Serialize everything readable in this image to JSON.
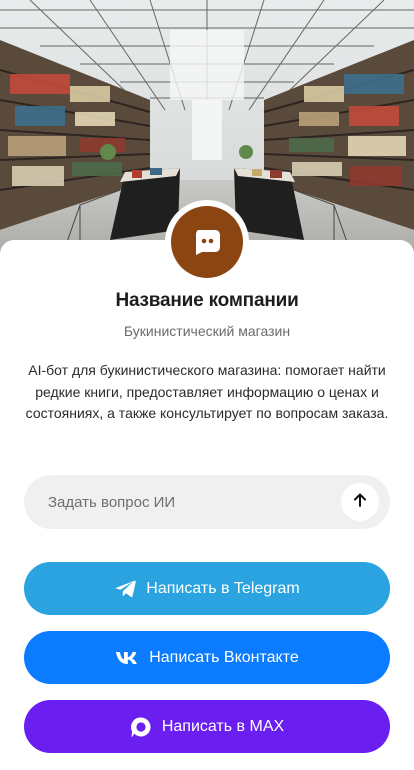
{
  "company": {
    "name": "Название компании",
    "subtitle": "Букинистический магазин",
    "description": "AI-бот для букинистического магазина: помогает найти редкие книги, предоставляет информацию о ценах и состояниях, а также консультирует по вопросам заказа."
  },
  "chat": {
    "placeholder": "Задать вопрос ИИ",
    "send_icon": "arrow-up-icon"
  },
  "buttons": {
    "telegram": {
      "label": "Написать в Telegram",
      "icon": "telegram-icon",
      "color": "#2aa3e0"
    },
    "vk": {
      "label": "Написать Вконтакте",
      "icon": "vk-icon",
      "color": "#0b7cff"
    },
    "max": {
      "label": "Написать в MAX",
      "icon": "max-icon",
      "color": "#6a1ff0"
    }
  },
  "colors": {
    "avatar_bg": "#8b4513",
    "input_bg": "#f0f0f0"
  }
}
